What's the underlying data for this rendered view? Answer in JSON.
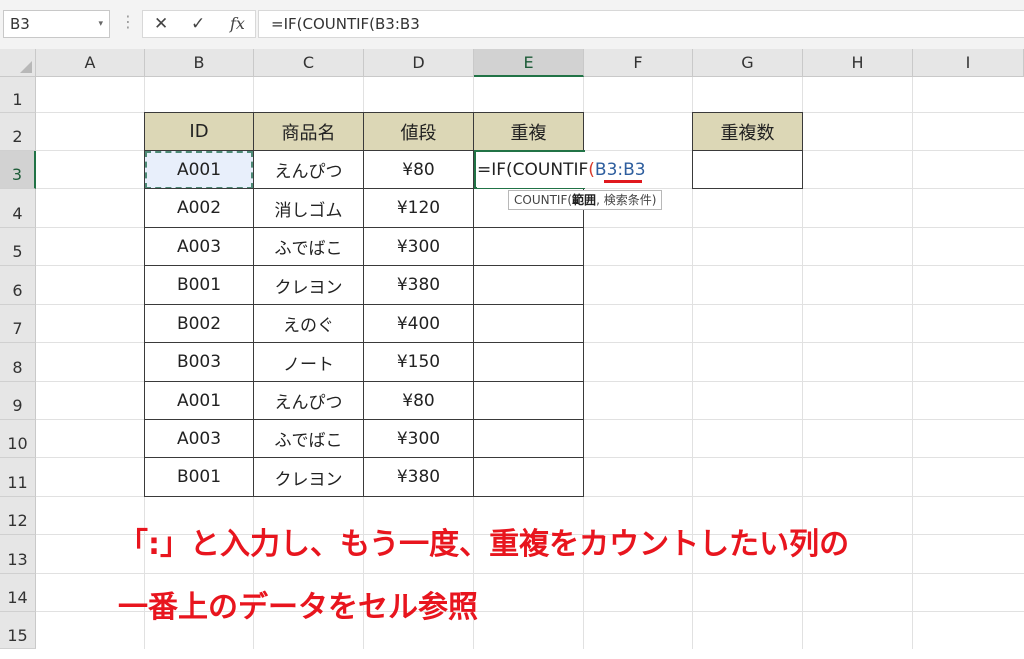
{
  "formula_bar": {
    "name_box": "B3",
    "name_box_dropdown": "▾",
    "separator": "⋮",
    "cancel_icon": "✕",
    "enter_icon": "✓",
    "fx_label": "fx",
    "formula": "=IF(COUNTIF(B3:B3"
  },
  "columns": [
    "A",
    "B",
    "C",
    "D",
    "E",
    "F",
    "G",
    "H",
    "I"
  ],
  "rows": [
    "1",
    "2",
    "3",
    "4",
    "5",
    "6",
    "7",
    "8",
    "9",
    "10",
    "11",
    "12",
    "13",
    "14",
    "15"
  ],
  "selected_column": "E",
  "selected_row": "3",
  "table": {
    "headers": [
      "ID",
      "商品名",
      "値段",
      "重複"
    ],
    "rows": [
      [
        "A001",
        "えんぴつ",
        "¥80"
      ],
      [
        "A002",
        "消しゴム",
        "¥120"
      ],
      [
        "A003",
        "ふでばこ",
        "¥300"
      ],
      [
        "B001",
        "クレヨン",
        "¥380"
      ],
      [
        "B002",
        "えのぐ",
        "¥400"
      ],
      [
        "B003",
        "ノート",
        "¥150"
      ],
      [
        "A001",
        "えんぴつ",
        "¥80"
      ],
      [
        "A003",
        "ふでばこ",
        "¥300"
      ],
      [
        "B001",
        "クレヨン",
        "¥380"
      ]
    ]
  },
  "count_table": {
    "header": "重複数",
    "value": ""
  },
  "editing": {
    "prefix": "=IF(COUNTIF",
    "open_paren": "(",
    "reference": "B3:B3"
  },
  "tooltip": {
    "func": "COUNTIF(",
    "arg_active": "範囲",
    "rest": ", 検索条件)"
  },
  "annotation": {
    "line1": "「:」と入力し、もう一度、重複をカウントしたい列の",
    "line2": "一番上のデータをセル参照"
  },
  "colors": {
    "header_fill": "#dcd7b6",
    "accent_green": "#217346",
    "annotation_red": "#e8151e",
    "reference_blue": "#2e5e9e"
  }
}
